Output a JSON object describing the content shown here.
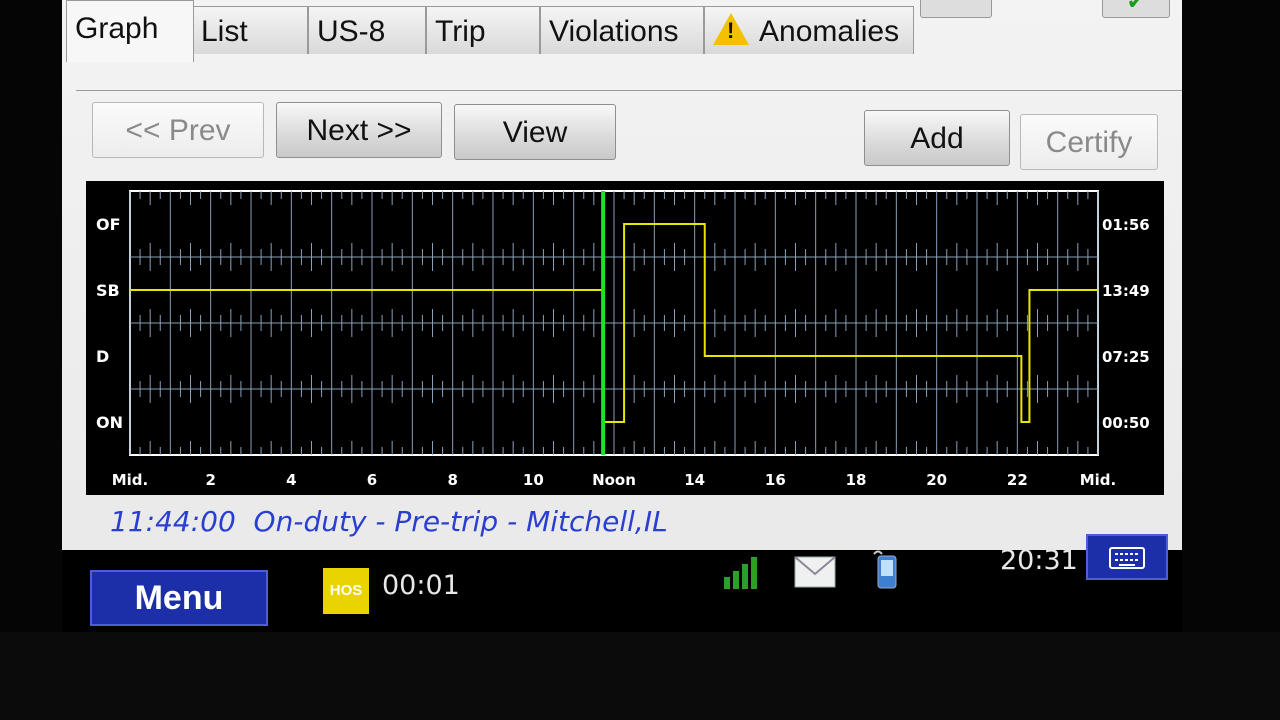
{
  "tabs": [
    {
      "label": "Graph",
      "active": true
    },
    {
      "label": "List"
    },
    {
      "label": "US-8"
    },
    {
      "label": "Trip"
    },
    {
      "label": "Violations"
    },
    {
      "label": "Anomalies",
      "icon": "warning-icon"
    }
  ],
  "toolbar": {
    "prev_label": "<< Prev",
    "next_label": "Next >>",
    "view_label": "View",
    "add_label": "Add",
    "certify_label": "Certify"
  },
  "chart_data": {
    "type": "line",
    "status_labels": [
      "OF",
      "SB",
      "D",
      "ON"
    ],
    "totals": [
      "01:56",
      "13:49",
      "07:25",
      "00:50"
    ],
    "x_tick_labels": [
      "Mid.",
      "2",
      "4",
      "6",
      "8",
      "10",
      "Noon",
      "14",
      "16",
      "18",
      "20",
      "22",
      "Mid."
    ],
    "xlim": [
      0,
      24
    ],
    "current_time_marker": 11.73,
    "segments": [
      {
        "status": "SB",
        "from": 0,
        "to": 11.73
      },
      {
        "status": "ON",
        "from": 11.73,
        "to": 12.25
      },
      {
        "status": "OF",
        "from": 12.25,
        "to": 14.25
      },
      {
        "status": "D",
        "from": 14.25,
        "to": 22.1
      },
      {
        "status": "ON",
        "from": 22.1,
        "to": 22.3
      },
      {
        "status": "SB",
        "from": 22.3,
        "to": 24
      }
    ],
    "colors": {
      "line": "#e6e600",
      "marker": "#22e022",
      "grid": "#8aa0b8",
      "background": "#000000"
    }
  },
  "status_line": "11:44:00  On-duty - Pre-trip - Mitchell,IL",
  "taskbar": {
    "menu_label": "Menu",
    "hos_icon_label": "HOS",
    "hos_time": "00:01",
    "clock": "20:31",
    "icons": [
      "signal-icon",
      "mail-icon",
      "phone-icon",
      "keyboard-icon"
    ]
  }
}
